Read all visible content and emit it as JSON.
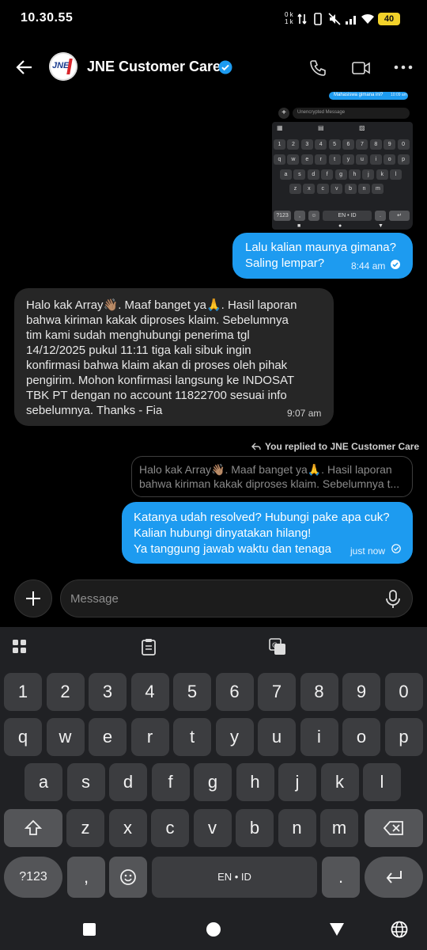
{
  "status_bar": {
    "time": "10.30.55",
    "network_speed": "0 k\n1 k",
    "battery": "40"
  },
  "header": {
    "title": "JNE Customer Care",
    "avatar_text": "JNE"
  },
  "screenshot_attachment": {
    "top_bubble_text": "Mahasiswa gimana ini?",
    "top_bubble_time": "10:09 am",
    "input_placeholder": "Unencrypted Message",
    "rows": [
      [
        "1",
        "2",
        "3",
        "4",
        "5",
        "6",
        "7",
        "8",
        "9",
        "0"
      ],
      [
        "q",
        "w",
        "e",
        "r",
        "t",
        "y",
        "u",
        "i",
        "o",
        "p"
      ],
      [
        "a",
        "s",
        "d",
        "f",
        "g",
        "h",
        "j",
        "k",
        "l"
      ],
      [
        "z",
        "x",
        "c",
        "v",
        "b",
        "n",
        "m"
      ]
    ],
    "space_label": "EN • ID",
    "symbols_label": "?123"
  },
  "messages": [
    {
      "direction": "out",
      "lines": [
        "Lalu kalian maunya gimana?",
        "Saling lempar?"
      ],
      "time": "8:44 am"
    },
    {
      "direction": "in",
      "lines": [
        "Halo kak Array👋🏽. Maaf banget ya🙏. Hasil laporan",
        "bahwa kiriman kakak diproses klaim. Sebelumnya",
        "tim kami sudah menghubungi penerima tgl",
        "14/12/2025 pukul 11:11 tiga kali sibuk ingin",
        "konfirmasi bahwa klaim akan di proses oleh pihak",
        "pengirim. Mohon konfirmasi langsung ke INDOSAT",
        "TBK PT dengan no account 11822700 sesuai info",
        "sebelumnya. Thanks - Fia"
      ],
      "time": "9:07 am"
    }
  ],
  "reply": {
    "label": "You replied to JNE Customer Care",
    "quote_lines": [
      "Halo kak Array👋🏽. Maaf banget ya🙏. Hasil laporan",
      "bahwa kiriman kakak diproses klaim. Sebelumnya t..."
    ],
    "lines": [
      "Katanya udah resolved? Hubungi pake apa cuk?",
      "Kalian hubungi dinyatakan hilang!",
      "Ya tanggung jawab waktu dan tenaga"
    ],
    "time": "just now"
  },
  "composer": {
    "placeholder": "Message"
  },
  "keyboard": {
    "row_numbers": [
      "1",
      "2",
      "3",
      "4",
      "5",
      "6",
      "7",
      "8",
      "9",
      "0"
    ],
    "row_top": [
      "q",
      "w",
      "e",
      "r",
      "t",
      "y",
      "u",
      "i",
      "o",
      "p"
    ],
    "row_home": [
      "a",
      "s",
      "d",
      "f",
      "g",
      "h",
      "j",
      "k",
      "l"
    ],
    "row_bottom": [
      "z",
      "x",
      "c",
      "v",
      "b",
      "n",
      "m"
    ],
    "symbols_label": "?123",
    "comma": ",",
    "period": ".",
    "space_label": "EN • ID"
  },
  "colors": {
    "accent": "#1d9bf0",
    "incoming_bubble": "#262626",
    "keyboard_bg": "#202124",
    "key_bg": "#3c3d40"
  }
}
